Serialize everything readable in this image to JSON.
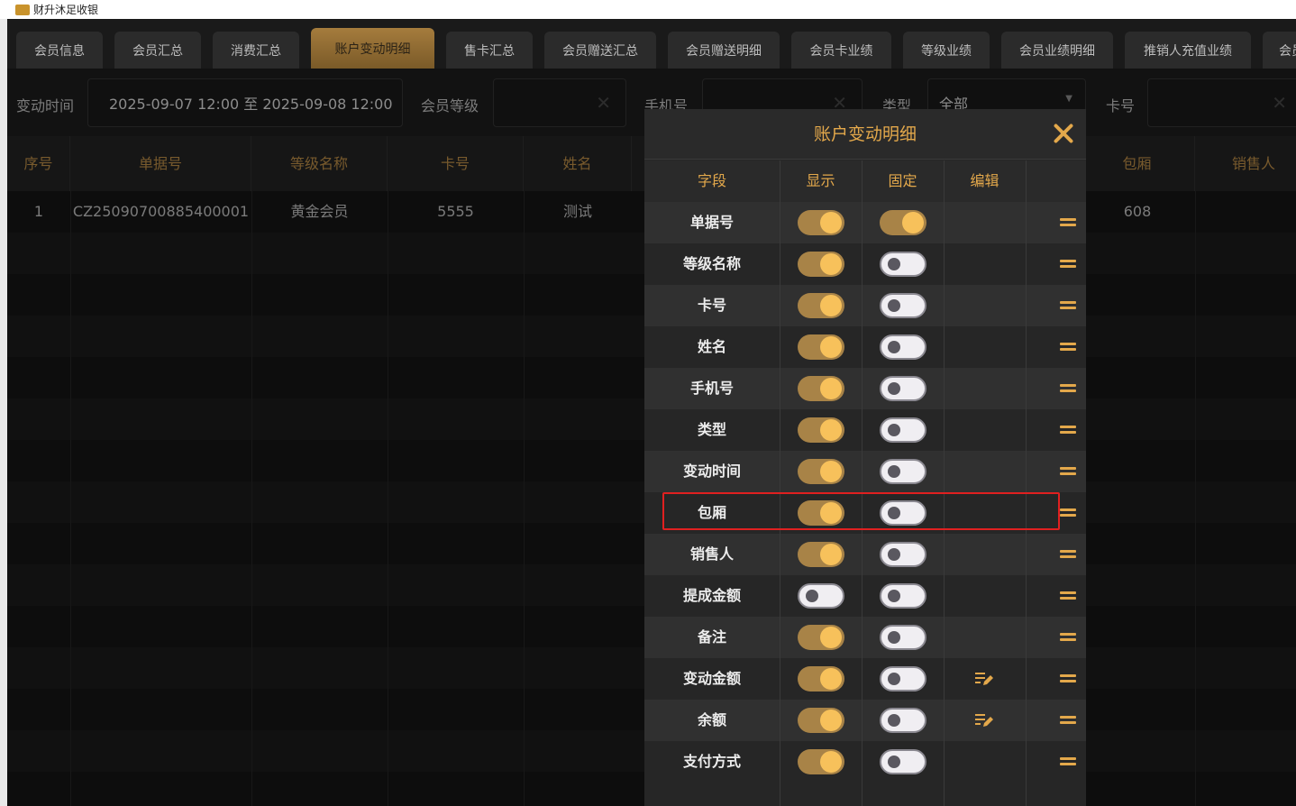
{
  "window": {
    "title": "财升沐足收银",
    "icon_label": "财升"
  },
  "tabs": [
    {
      "label": "会员信息",
      "active": false
    },
    {
      "label": "会员汇总",
      "active": false
    },
    {
      "label": "消费汇总",
      "active": false
    },
    {
      "label": "账户变动明细",
      "active": true
    },
    {
      "label": "售卡汇总",
      "active": false
    },
    {
      "label": "会员赠送汇总",
      "active": false
    },
    {
      "label": "会员赠送明细",
      "active": false
    },
    {
      "label": "会员卡业绩",
      "active": false
    },
    {
      "label": "等级业绩",
      "active": false
    },
    {
      "label": "会员业绩明细",
      "active": false
    },
    {
      "label": "推销人充值业绩",
      "active": false
    },
    {
      "label": "会员",
      "active": false
    }
  ],
  "filters": {
    "change_time_label": "变动时间",
    "change_time_value": "2025-09-07 12:00 至 2025-09-08 12:00",
    "member_level_label": "会员等级",
    "member_level_value": "",
    "phone_label": "手机号",
    "phone_value": "",
    "type_label": "类型",
    "type_value": "全部",
    "card_label": "卡号",
    "card_value": ""
  },
  "table": {
    "headers": [
      "序号",
      "单据号",
      "等级名称",
      "卡号",
      "姓名",
      "包厢",
      "销售人"
    ],
    "rows": [
      {
        "index": "1",
        "doc_no": "CZ25090700885400001",
        "level": "黄金会员",
        "card": "5555",
        "name": "测试",
        "room": "608",
        "seller": ""
      }
    ]
  },
  "modal": {
    "title": "账户变动明细",
    "headers": {
      "field": "字段",
      "show": "显示",
      "fixed": "固定",
      "edit": "编辑"
    },
    "rows": [
      {
        "field": "单据号",
        "show": true,
        "fixed": true,
        "editable": false
      },
      {
        "field": "等级名称",
        "show": true,
        "fixed": false,
        "editable": false
      },
      {
        "field": "卡号",
        "show": true,
        "fixed": false,
        "editable": false
      },
      {
        "field": "姓名",
        "show": true,
        "fixed": false,
        "editable": false
      },
      {
        "field": "手机号",
        "show": true,
        "fixed": false,
        "editable": false
      },
      {
        "field": "类型",
        "show": true,
        "fixed": false,
        "editable": false
      },
      {
        "field": "变动时间",
        "show": true,
        "fixed": false,
        "editable": false
      },
      {
        "field": "包厢",
        "show": true,
        "fixed": false,
        "editable": false
      },
      {
        "field": "销售人",
        "show": true,
        "fixed": false,
        "editable": false
      },
      {
        "field": "提成金额",
        "show": false,
        "fixed": false,
        "editable": false
      },
      {
        "field": "备注",
        "show": true,
        "fixed": false,
        "editable": false
      },
      {
        "field": "变动金额",
        "show": true,
        "fixed": false,
        "editable": true
      },
      {
        "field": "余额",
        "show": true,
        "fixed": false,
        "editable": true
      },
      {
        "field": "支付方式",
        "show": true,
        "fixed": false,
        "editable": false
      }
    ]
  },
  "colors": {
    "accent": "#e3a84b",
    "toggle_on_track": "#a88347",
    "toggle_on_knob": "#f7c15b",
    "highlight_box": "#e02020"
  }
}
